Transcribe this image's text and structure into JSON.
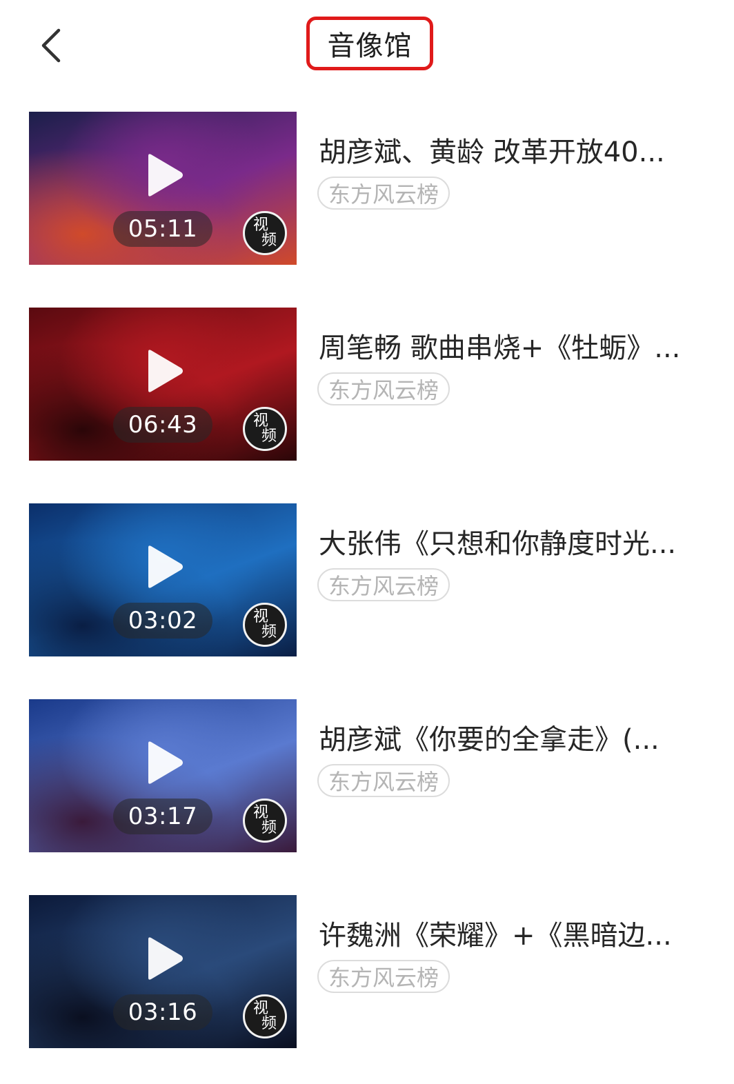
{
  "header": {
    "back_icon": "chevron-left-icon",
    "title": "音像馆",
    "title_highlight_color": "#e01a1a"
  },
  "videos": [
    {
      "title": "胡彦斌、黄龄 改革开放40...",
      "duration": "05:11",
      "tag": "东方风云榜",
      "badge_top": "视",
      "badge_bottom": "频",
      "thumb_colors": [
        "#1b1f4a",
        "#7a2a8a",
        "#d04a2a"
      ]
    },
    {
      "title": "周笔畅 歌曲串烧+《牡蛎》...",
      "duration": "06:43",
      "tag": "东方风云榜",
      "badge_top": "视",
      "badge_bottom": "频",
      "thumb_colors": [
        "#5a0a10",
        "#b01820",
        "#2a0608"
      ]
    },
    {
      "title": "大张伟《只想和你静度时光...",
      "duration": "03:02",
      "tag": "东方风云榜",
      "badge_top": "视",
      "badge_bottom": "频",
      "thumb_colors": [
        "#0b2f6a",
        "#1f6fc0",
        "#0a1e44"
      ]
    },
    {
      "title": "胡彦斌《你要的全拿走》(...",
      "duration": "03:17",
      "tag": "东方风云榜",
      "badge_top": "视",
      "badge_bottom": "频",
      "thumb_colors": [
        "#1a3a8a",
        "#5a7ad0",
        "#3a1a3a"
      ]
    },
    {
      "title": "许魏洲《荣耀》+《黑暗边...",
      "duration": "03:16",
      "tag": "东方风云榜",
      "badge_top": "视",
      "badge_bottom": "频",
      "thumb_colors": [
        "#0c1a3a",
        "#2a4a7a",
        "#0a0f20"
      ]
    }
  ]
}
